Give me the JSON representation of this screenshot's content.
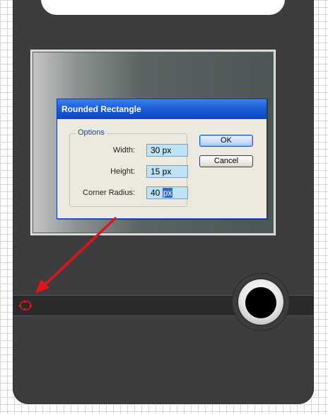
{
  "dialog": {
    "title": "Rounded Rectangle",
    "options_label": "Options",
    "fields": [
      {
        "label": "Width:",
        "value": "30 px"
      },
      {
        "label": "Height:",
        "value": "15 px"
      },
      {
        "label": "Corner Radius:",
        "value_plain": "40 ",
        "value_selected": "px"
      }
    ],
    "ok_label": "OK",
    "cancel_label": "Cancel"
  },
  "colors": {
    "device_body": "#3d3d3f",
    "titlebar_blue": "#0a46c8",
    "field_bg": "#bfe3f6",
    "annotation_arrow": "#e0151c"
  },
  "icons": {
    "annotation": "red-arrow-icon",
    "anchor": "selection-marker-icon"
  }
}
